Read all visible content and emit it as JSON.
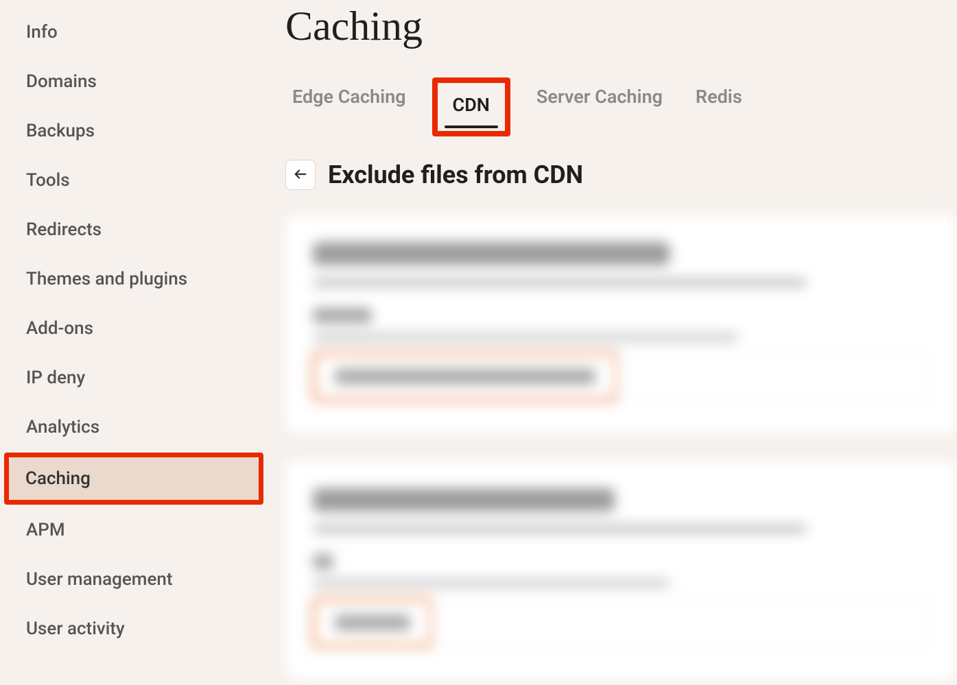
{
  "sidebar": {
    "items": [
      {
        "label": "Info",
        "active": false
      },
      {
        "label": "Domains",
        "active": false
      },
      {
        "label": "Backups",
        "active": false
      },
      {
        "label": "Tools",
        "active": false
      },
      {
        "label": "Redirects",
        "active": false
      },
      {
        "label": "Themes and plugins",
        "active": false
      },
      {
        "label": "Add-ons",
        "active": false
      },
      {
        "label": "IP deny",
        "active": false
      },
      {
        "label": "Analytics",
        "active": false
      },
      {
        "label": "Caching",
        "active": true,
        "highlighted": true
      },
      {
        "label": "APM",
        "active": false
      },
      {
        "label": "User management",
        "active": false
      },
      {
        "label": "User activity",
        "active": false
      }
    ]
  },
  "page": {
    "title": "Caching"
  },
  "tabs": {
    "items": [
      {
        "label": "Edge Caching",
        "active": false
      },
      {
        "label": "CDN",
        "active": true,
        "highlighted": true
      },
      {
        "label": "Server Caching",
        "active": false
      },
      {
        "label": "Redis",
        "active": false
      }
    ]
  },
  "section": {
    "title": "Exclude files from CDN"
  },
  "annotation_highlights": {
    "color": "#e92a00",
    "targets": [
      "sidebar-item-caching",
      "tab-cdn"
    ]
  }
}
